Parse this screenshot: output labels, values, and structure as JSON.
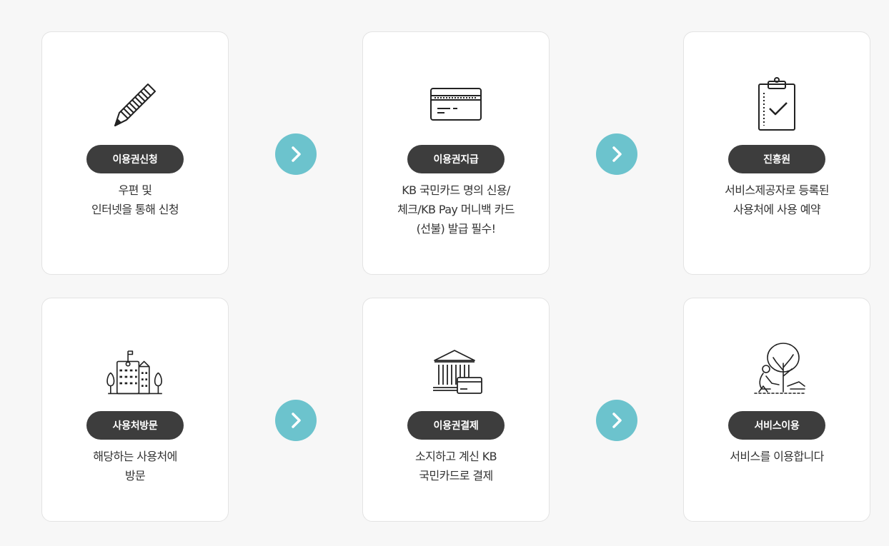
{
  "steps": [
    {
      "label": "이용권신청",
      "icon": "pencil-icon",
      "lines": [
        "우편 및",
        "인터넷을 통해 신청"
      ]
    },
    {
      "label": "이용권지급",
      "icon": "credit-card-icon",
      "lines": [
        "KB 국민카드 명의 신용/",
        "체크/KB Pay 머니백 카드",
        "(선불) 발급 필수!"
      ]
    },
    {
      "label": "진흥원",
      "icon": "clipboard-check-icon",
      "lines": [
        "서비스제공자로 등록된",
        "사용처에 사용 예약"
      ]
    },
    {
      "label": "사용처방문",
      "icon": "building-icon",
      "lines": [
        "해당하는 사용처에",
        "방문"
      ]
    },
    {
      "label": "이용권결제",
      "icon": "bank-card-icon",
      "lines": [
        "소지하고 계신 KB",
        "국민카드로 결제"
      ]
    },
    {
      "label": "서비스이용",
      "icon": "relax-tree-icon",
      "lines": [
        "서비스를 이용합니다"
      ]
    }
  ],
  "colors": {
    "accent": "#6cc3cd",
    "pill": "#3d3d3d",
    "background": "#f7f7f7"
  }
}
